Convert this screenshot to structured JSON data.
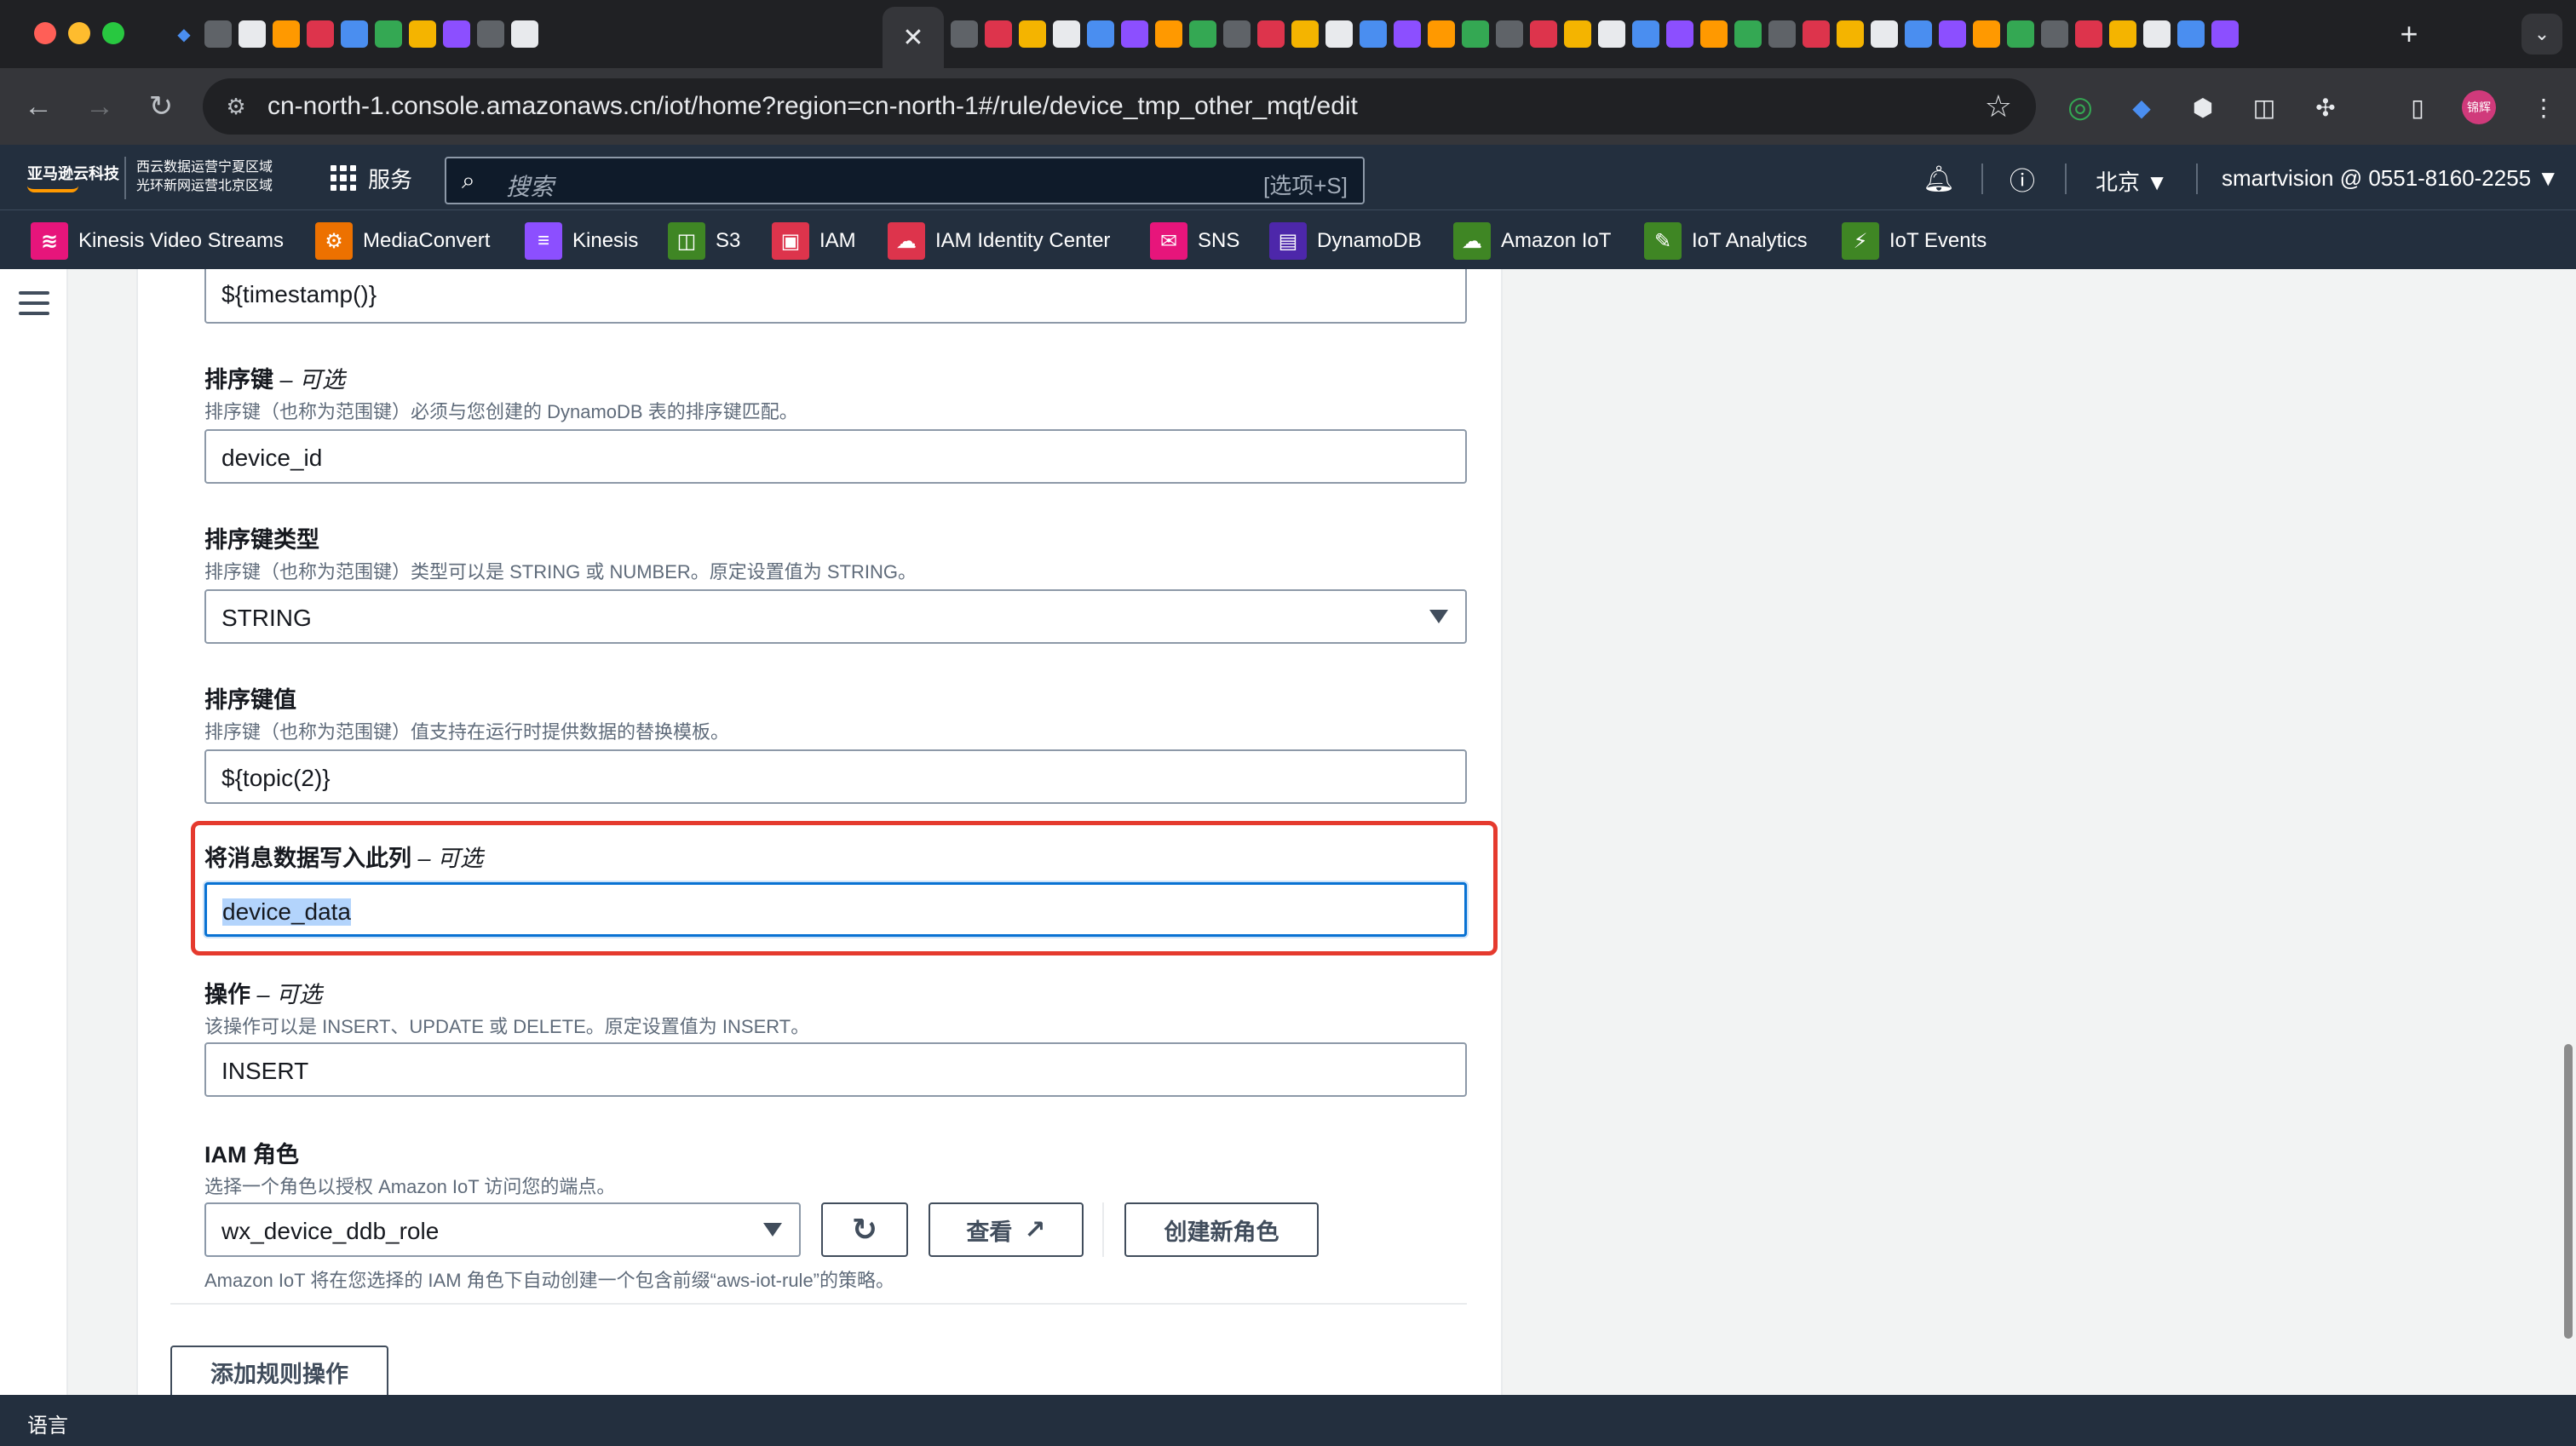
{
  "browser": {
    "tab_close_glyph": "✕",
    "new_tab_glyph": "+",
    "tab_menu_glyph": "⌄",
    "url": "cn-north-1.console.amazonaws.cn/iot/home?region=cn-north-1#/rule/device_tmp_other_mqt/edit",
    "profile_label": "锦辉"
  },
  "aws_header": {
    "logo_text": "亚马逊云科技",
    "region_line1": "西云数据运营宁夏区域",
    "region_line2": "光环新网运营北京区域",
    "services_label": "服务",
    "search_placeholder": "搜索",
    "search_shortcut": "[选项+S]",
    "region_selector": "北京 ▼",
    "account": "smartvision @ 0551-8160-2255 ▼"
  },
  "favorites": [
    {
      "label": "Kinesis Video Streams",
      "color": "#e7157b",
      "glyph": "≋"
    },
    {
      "label": "MediaConvert",
      "color": "#ed7100",
      "glyph": "⚙"
    },
    {
      "label": "Kinesis",
      "color": "#8c4fff",
      "glyph": "≡"
    },
    {
      "label": "S3",
      "color": "#3f8624",
      "glyph": "◫"
    },
    {
      "label": "IAM",
      "color": "#dd344c",
      "glyph": "▣"
    },
    {
      "label": "IAM Identity Center",
      "color": "#dd344c",
      "glyph": "☁"
    },
    {
      "label": "SNS",
      "color": "#e7157b",
      "glyph": "✉"
    },
    {
      "label": "DynamoDB",
      "color": "#4d27aa",
      "glyph": "▤"
    },
    {
      "label": "Amazon IoT",
      "color": "#3f8624",
      "glyph": "☁"
    },
    {
      "label": "IoT Analytics",
      "color": "#3f8624",
      "glyph": "✎"
    },
    {
      "label": "IoT Events",
      "color": "#3f8624",
      "glyph": "⚡"
    }
  ],
  "form": {
    "top_field_value": "${timestamp()}",
    "sort_key": {
      "label": "排序键",
      "optional": "– 可选",
      "description": "排序键（也称为范围键）必须与您创建的 DynamoDB 表的排序键匹配。",
      "value": "device_id"
    },
    "sort_key_type": {
      "label": "排序键类型",
      "description": "排序键（也称为范围键）类型可以是 STRING 或 NUMBER。原定设置值为 STRING。",
      "value": "STRING"
    },
    "sort_key_value": {
      "label": "排序键值",
      "description": "排序键（也称为范围键）值支持在运行时提供数据的替换模板。",
      "value": "${topic(2)}"
    },
    "payload_column": {
      "label": "将消息数据写入此列",
      "optional": "– 可选",
      "value": "device_data"
    },
    "operation": {
      "label": "操作",
      "optional": "– 可选",
      "description": "该操作可以是 INSERT、UPDATE 或 DELETE。原定设置值为 INSERT。",
      "value": "INSERT"
    },
    "iam_role": {
      "label": "IAM 角色",
      "description": "选择一个角色以授权 Amazon IoT 访问您的端点。",
      "value": "wx_device_ddb_role",
      "view_label": "查看",
      "create_label": "创建新角色",
      "note": "Amazon IoT 将在您选择的 IAM 角色下自动创建一个包含前缀“aws-iot-rule”的策略。"
    },
    "add_action_label": "添加规则操作"
  },
  "footer": {
    "language_label": "语言"
  },
  "colors": {
    "aws_navy": "#232f3e",
    "highlight_red": "#e53a2e",
    "focus_blue": "#0972d3"
  }
}
